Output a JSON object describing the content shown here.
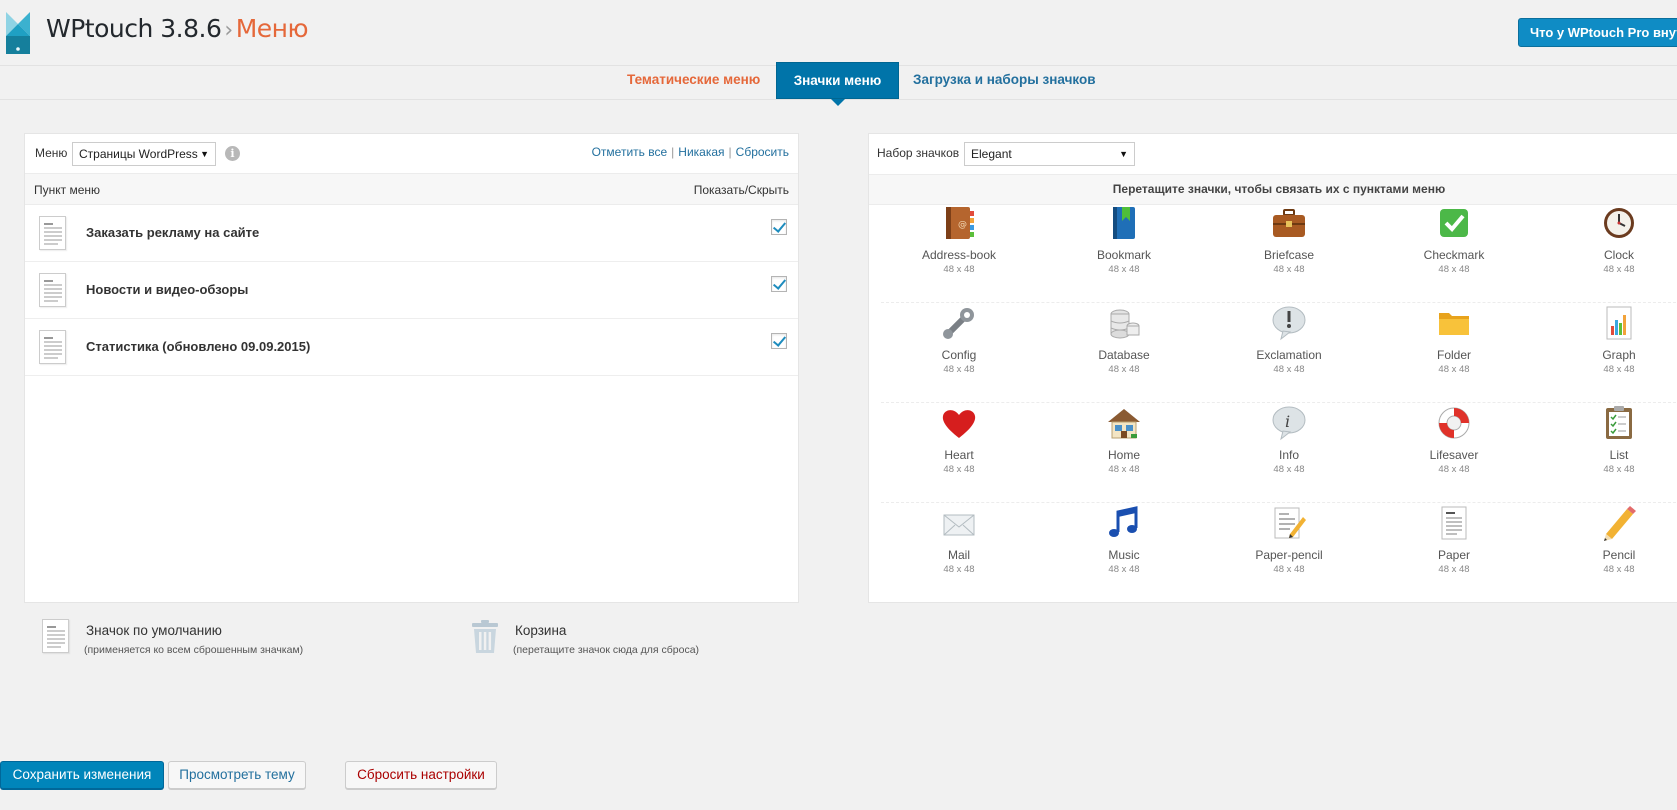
{
  "header": {
    "product": "WPtouch 3.8.6",
    "separator": "›",
    "crumb": "Меню",
    "pro_button": "Что у WPtouch Pro внутри?"
  },
  "tabs": [
    {
      "label": "Тематические меню",
      "active": false
    },
    {
      "label": "Значки меню",
      "active": true
    },
    {
      "label": "Загрузка и наборы значков",
      "active": false
    }
  ],
  "menu_panel": {
    "menu_label": "Меню",
    "menu_select": "Страницы WordPress",
    "info_icon": "info-icon",
    "links": {
      "check_all": "Отметить все",
      "none": "Никакая",
      "reset": "Сбросить"
    },
    "col_item": "Пункт меню",
    "col_toggle": "Показать/Скрыть",
    "items": [
      {
        "label": "Заказать рекламу на сайте",
        "checked": true
      },
      {
        "label": "Новости и видео-обзоры",
        "checked": true
      },
      {
        "label": "Статистика (обновлено 09.09.2015)",
        "checked": true
      }
    ]
  },
  "icon_panel": {
    "set_label": "Набор значков",
    "set_select": "Elegant",
    "hint": "Перетащите значки, чтобы связать их с пунктами меню",
    "size": "48 x 48",
    "icons": [
      "Address-book",
      "Bookmark",
      "Briefcase",
      "Checkmark",
      "Clock",
      "Config",
      "Database",
      "Exclamation",
      "Folder",
      "Graph",
      "Heart",
      "Home",
      "Info",
      "Lifesaver",
      "List",
      "Mail",
      "Music",
      "Paper-pencil",
      "Paper",
      "Pencil"
    ]
  },
  "bottom": {
    "default_icon_title": "Значок по умолчанию",
    "default_icon_sub": "(применяется ко всем сброшенным значкам)",
    "trash_title": "Корзина",
    "trash_sub": "(перетащите значок сюда для сброса)"
  },
  "buttons": {
    "save": "Сохранить изменения",
    "view": "Просмотреть тему",
    "reset": "Сбросить настройки"
  },
  "colors": {
    "accent": "#0085ba",
    "tab_active": "#0074a9",
    "crumb": "#e5683a",
    "link": "#23709e"
  }
}
